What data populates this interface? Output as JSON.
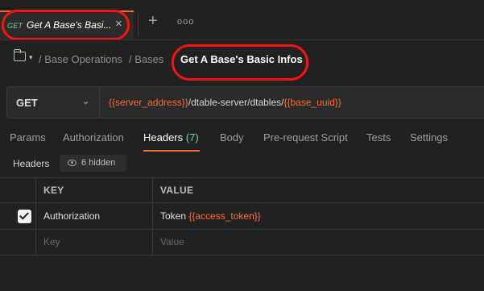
{
  "tabs": {
    "active": {
      "method": "GET",
      "title": "Get A Base's Basi...",
      "close_glyph": "×"
    },
    "new_tab_glyph": "+",
    "more_glyph": "ooo"
  },
  "breadcrumb": {
    "caret_glyph": "▾",
    "items": [
      "/ Base Operations",
      "/ Bases"
    ],
    "current": "Get A Base's Basic Infos"
  },
  "request": {
    "method": "GET",
    "chevron_glyph": "⌄",
    "url": {
      "var1": "{{server_address}}",
      "middle": "/dtable-server/dtables/",
      "var2": "{{base_uuid}}"
    }
  },
  "subtabs": {
    "params": "Params",
    "authorization": "Authorization",
    "headers": "Headers",
    "headers_count": "(7)",
    "body": "Body",
    "prerequest": "Pre-request Script",
    "tests": "Tests",
    "settings": "Settings"
  },
  "headers_section": {
    "label": "Headers",
    "hidden": "6 hidden"
  },
  "table": {
    "columns": [
      "KEY",
      "VALUE"
    ],
    "rows": [
      {
        "checked": true,
        "key": "Authorization",
        "value_prefix": "Token ",
        "value_var": "{{access_token}}"
      }
    ],
    "placeholder": {
      "key": "Key",
      "value": "Value"
    }
  },
  "colors": {
    "accent": "#ff6c37",
    "get_method": "#6bdd9a",
    "annotation_ring": "#ff1010",
    "background": "#212121"
  }
}
